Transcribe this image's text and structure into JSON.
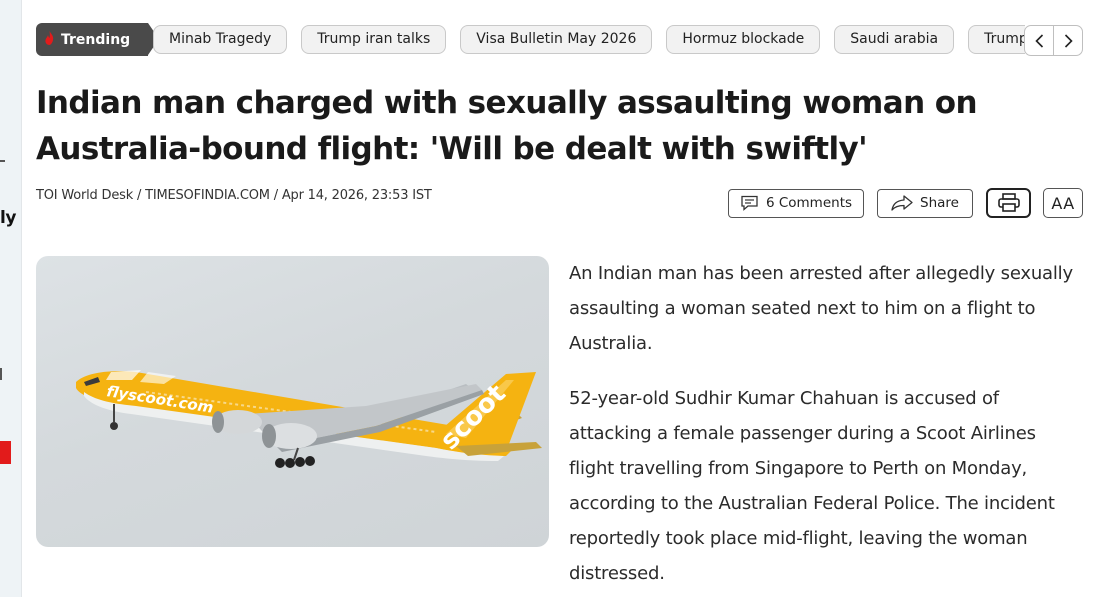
{
  "left_panel": {
    "fragment_text": "ly"
  },
  "trending": {
    "badge_label": "Trending",
    "topics": [
      "Minab Tragedy",
      "Trump iran talks",
      "Visa Bulletin May 2026",
      "Hormuz blockade",
      "Saudi arabia",
      "Trump"
    ],
    "prev_icon": "chevron-left-icon",
    "next_icon": "chevron-right-icon"
  },
  "article": {
    "headline": "Indian man charged with sexually assaulting woman on Australia-bound flight: 'Will be dealt with swiftly'",
    "byline": "TOI World Desk / TIMESOFINDIA.COM / Apr 14, 2026, 23:53 IST",
    "paragraphs": [
      "An Indian man has been arrested after allegedly sexually assaulting a woman seated next to him on a flight to Australia.",
      "52-year-old Sudhir Kumar Chahuan is accused of attacking a female passenger during a Scoot Airlines flight travelling from Singapore to Perth on Monday, according to the Australian Federal Police. The incident reportedly took place mid-flight, leaving the woman distressed."
    ],
    "image": {
      "fuselage_text": "flyscoot.com",
      "tail_text": "scoot"
    }
  },
  "actions": {
    "comments_label": "6 Comments",
    "share_label": "Share",
    "font_size_label": "AA"
  },
  "colors": {
    "trending_badge": "#4a4a4a",
    "flame": "#e21b1b",
    "scoot_yellow": "#f5b311"
  }
}
